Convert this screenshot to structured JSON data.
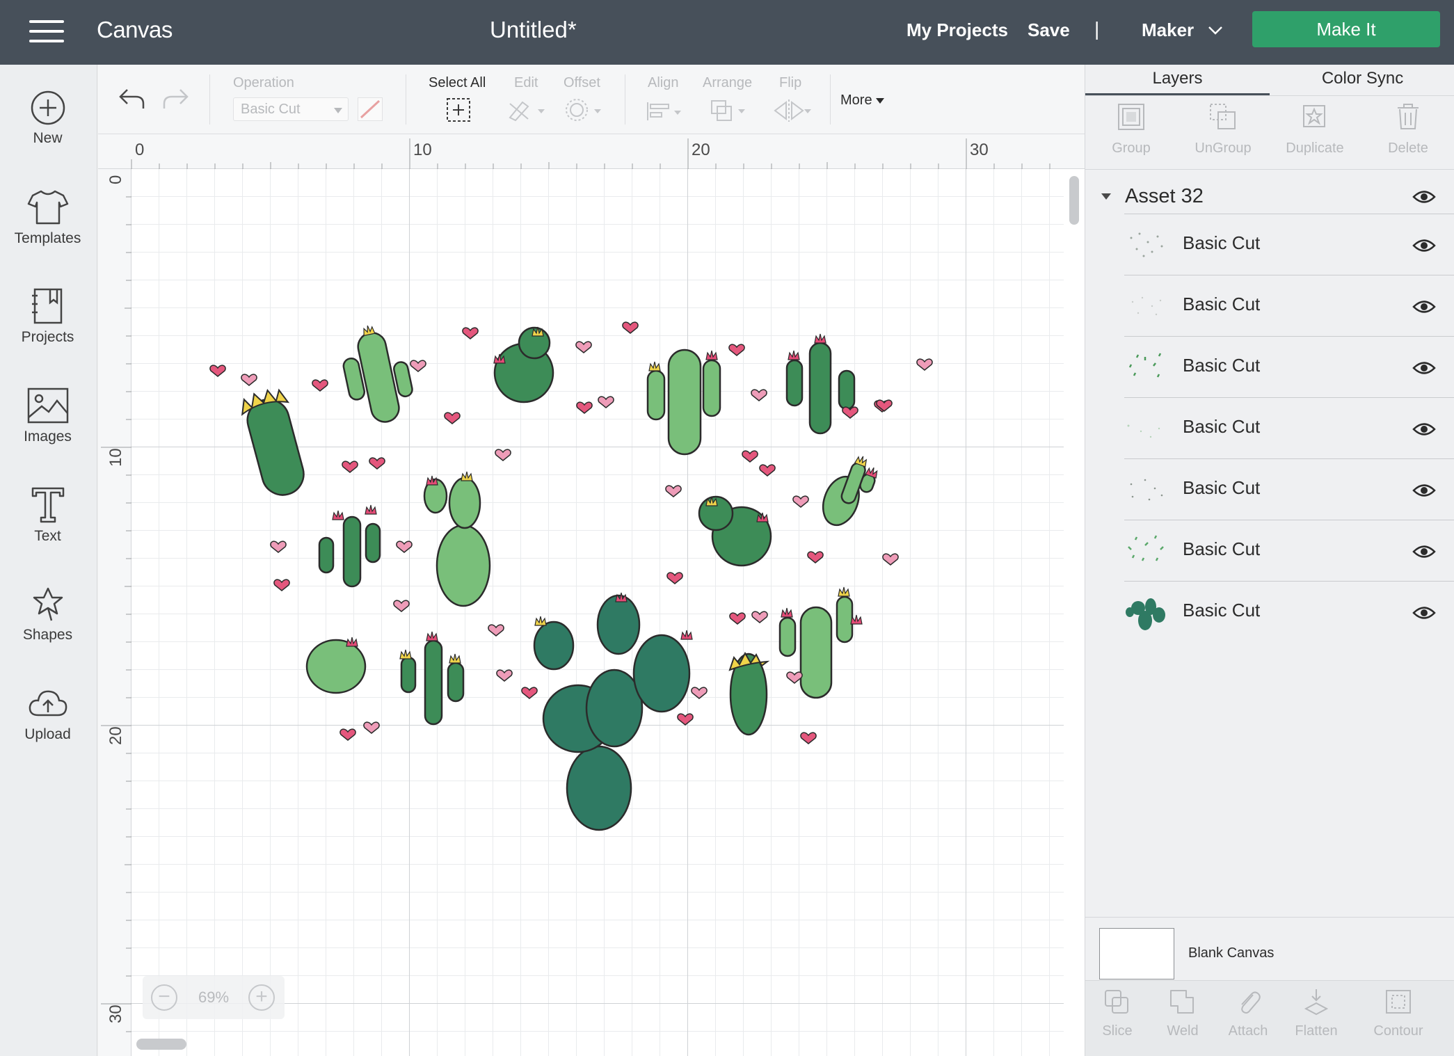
{
  "topbar": {
    "app_title": "Canvas",
    "document_title": "Untitled*",
    "my_projects": "My Projects",
    "save": "Save",
    "separator": "|",
    "machine": "Maker",
    "make_it": "Make It",
    "make_it_color": "#2fa06a",
    "bar_color": "#47505a"
  },
  "leftrail": {
    "items": [
      {
        "label": "New",
        "icon": "plus-circle-icon"
      },
      {
        "label": "Templates",
        "icon": "shirt-icon"
      },
      {
        "label": "Projects",
        "icon": "projects-icon"
      },
      {
        "label": "Images",
        "icon": "image-icon"
      },
      {
        "label": "Text",
        "icon": "text-icon"
      },
      {
        "label": "Shapes",
        "icon": "shapes-icon"
      },
      {
        "label": "Upload",
        "icon": "cloud-upload-icon"
      }
    ]
  },
  "toolbar": {
    "operation_label": "Operation",
    "operation_value": "Basic Cut",
    "select_all": "Select All",
    "edit": "Edit",
    "offset": "Offset",
    "align": "Align",
    "arrange": "Arrange",
    "flip": "Flip",
    "more": "More"
  },
  "canvas": {
    "ruler_top": [
      "0",
      "10",
      "20",
      "30"
    ],
    "ruler_left": [
      "0",
      "10",
      "20",
      "30"
    ],
    "zoom": "69%",
    "zoom_out": "−",
    "zoom_in": "+"
  },
  "panel": {
    "tabs": [
      "Layers",
      "Color Sync"
    ],
    "tools": [
      "Group",
      "UnGroup",
      "Duplicate",
      "Delete"
    ],
    "group_name": "Asset 32",
    "layers": [
      {
        "name": "Basic Cut",
        "thumb": "dots"
      },
      {
        "name": "Basic Cut",
        "thumb": "dots-faint"
      },
      {
        "name": "Basic Cut",
        "thumb": "green-flecks"
      },
      {
        "name": "Basic Cut",
        "thumb": "dots-faint"
      },
      {
        "name": "Basic Cut",
        "thumb": "dots"
      },
      {
        "name": "Basic Cut",
        "thumb": "green-flecks"
      },
      {
        "name": "Basic Cut",
        "thumb": "cactus"
      }
    ],
    "blank_canvas": "Blank Canvas",
    "bottom_tools": [
      "Slice",
      "Weld",
      "Attach",
      "Flatten",
      "Contour"
    ]
  }
}
